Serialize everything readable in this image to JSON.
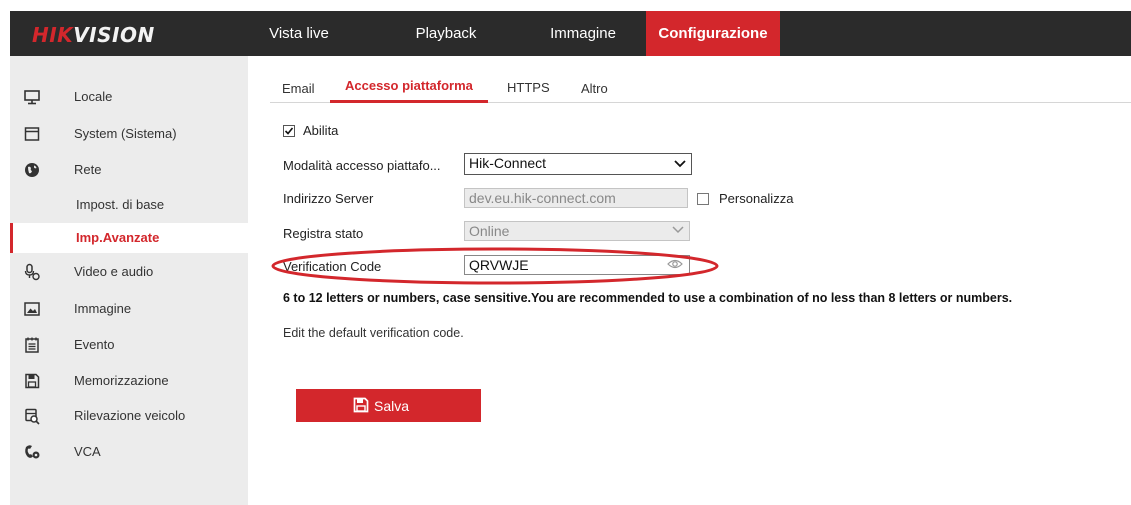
{
  "brand": {
    "logo_red": "HIK",
    "logo_white": "VISION"
  },
  "top_nav": [
    {
      "label": "Vista live"
    },
    {
      "label": "Playback"
    },
    {
      "label": "Immagine"
    },
    {
      "label": "Configurazione",
      "active": true
    }
  ],
  "sidebar": {
    "items": [
      {
        "label": "Locale",
        "icon": "monitor-icon"
      },
      {
        "label": "System (Sistema)",
        "icon": "window-icon"
      },
      {
        "label": "Rete",
        "icon": "globe-icon"
      },
      {
        "label": "Impost. di base",
        "sub": true
      },
      {
        "label": "Imp.Avanzate",
        "sub": true,
        "active": true
      },
      {
        "label": "Video e audio",
        "icon": "microphone-icon"
      },
      {
        "label": "Immagine",
        "icon": "image-icon"
      },
      {
        "label": "Evento",
        "icon": "calendar-icon"
      },
      {
        "label": "Memorizzazione",
        "icon": "floppy-disk-icon"
      },
      {
        "label": "Rilevazione veicolo",
        "icon": "vehicle-search-icon"
      },
      {
        "label": "VCA",
        "icon": "vca-icon"
      }
    ]
  },
  "content_tabs": [
    {
      "label": "Email"
    },
    {
      "label": "Accesso piattaforma",
      "active": true
    },
    {
      "label": "HTTPS"
    },
    {
      "label": "Altro"
    }
  ],
  "form": {
    "enable_label": "Abilita",
    "enable_checked": true,
    "mode_label": "Modalità accesso piattafo...",
    "mode_value": "Hik-Connect",
    "server_label": "Indirizzo Server",
    "server_value": "dev.eu.hik-connect.com",
    "custom_label": "Personalizza",
    "custom_checked": false,
    "status_label": "Registra stato",
    "status_value": "Online",
    "verification_label": "Verification Code",
    "verification_value": "QRVWJE",
    "hint_bold": "6 to 12 letters or numbers, case sensitive.You are recommended to use a combination of no less than 8 letters or numbers.",
    "hint": "Edit the default verification code."
  },
  "save_label": "Salva",
  "colors": {
    "accent": "#d3272c",
    "topbar": "#2b2b2b",
    "sidebar": "#ececec"
  }
}
